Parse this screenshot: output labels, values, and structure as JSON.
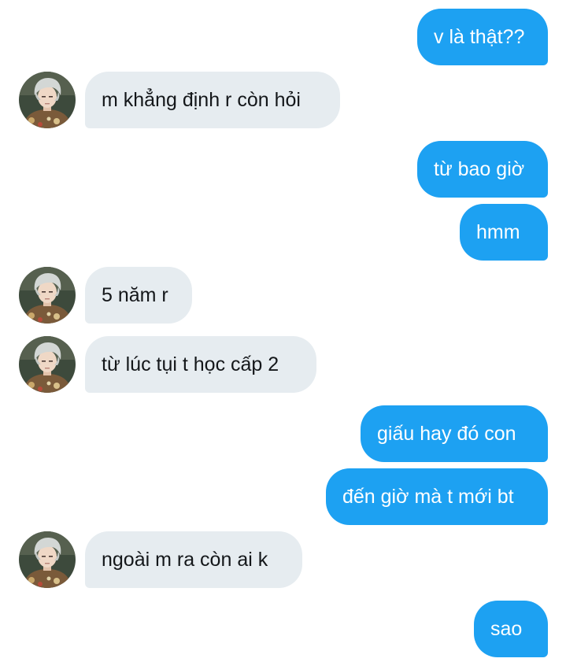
{
  "colors": {
    "outgoing_bubble": "#1da1f2",
    "incoming_bubble": "#e6ecf0",
    "outgoing_text": "#ffffff",
    "incoming_text": "#14171a"
  },
  "messages": [
    {
      "direction": "outgoing",
      "text": "v là thật??"
    },
    {
      "direction": "incoming",
      "text": "m khẳng định r còn hỏi",
      "avatar": "contact-avatar"
    },
    {
      "direction": "outgoing",
      "text": "từ bao giờ"
    },
    {
      "direction": "outgoing",
      "text": "hmm"
    },
    {
      "direction": "incoming",
      "text": "5 năm r",
      "avatar": "contact-avatar"
    },
    {
      "direction": "incoming",
      "text": "từ lúc tụi t học cấp 2",
      "avatar": "contact-avatar"
    },
    {
      "direction": "outgoing",
      "text": "giấu hay đó con"
    },
    {
      "direction": "outgoing",
      "text": "đến giờ mà t mới bt"
    },
    {
      "direction": "incoming",
      "text": "ngoài m ra còn ai k",
      "avatar": "contact-avatar"
    },
    {
      "direction": "outgoing",
      "text": "sao"
    }
  ]
}
